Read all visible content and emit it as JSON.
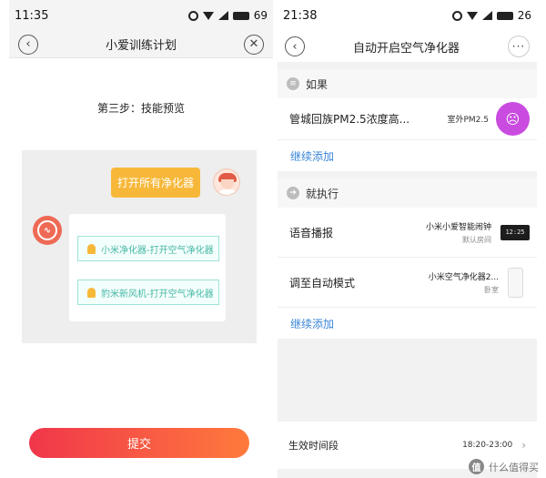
{
  "left": {
    "status": {
      "time": "11:35",
      "battery": "69"
    },
    "nav": {
      "title": "小爱训练计划",
      "back_glyph": "‹",
      "close_glyph": "✕"
    },
    "step_title": "第三步：技能预览",
    "user_bubble": "打开所有净化器",
    "skills": [
      "小米净化器-打开空气净化器",
      "豹米新风机-打开空气净化器"
    ],
    "submit_label": "提交",
    "colors": {
      "bubble": "#f7b83a",
      "skill_text": "#45b6a4",
      "submit_start": "#f0364b",
      "submit_end": "#ff7a3c"
    }
  },
  "right": {
    "status": {
      "time": "21:38",
      "battery": "26"
    },
    "nav": {
      "title": "自动开启空气净化器",
      "back_glyph": "‹",
      "more_glyph": "···"
    },
    "if_section": {
      "title": "如果",
      "condition": {
        "text": "管城回族PM2.5浓度高...",
        "sub": "室外PM2.5"
      },
      "add_label": "继续添加"
    },
    "then_section": {
      "title": "就执行",
      "actions": [
        {
          "label": "语音播报",
          "device": "小米小爱智能闹钟",
          "room": "默认房间",
          "icon": "alarm-clock-icon",
          "icon_text": "12:25"
        },
        {
          "label": "调至自动模式",
          "device": "小米空气净化器2...",
          "room": "卧室",
          "icon": "air-purifier-icon"
        }
      ],
      "add_label": "继续添加"
    },
    "effective": {
      "label": "生效时间段",
      "value": "18:20-23:00"
    },
    "colors": {
      "add_link": "#3a85d8",
      "pm_icon": "#c94be0"
    }
  },
  "watermark": {
    "badge": "值",
    "text": "什么值得买"
  }
}
